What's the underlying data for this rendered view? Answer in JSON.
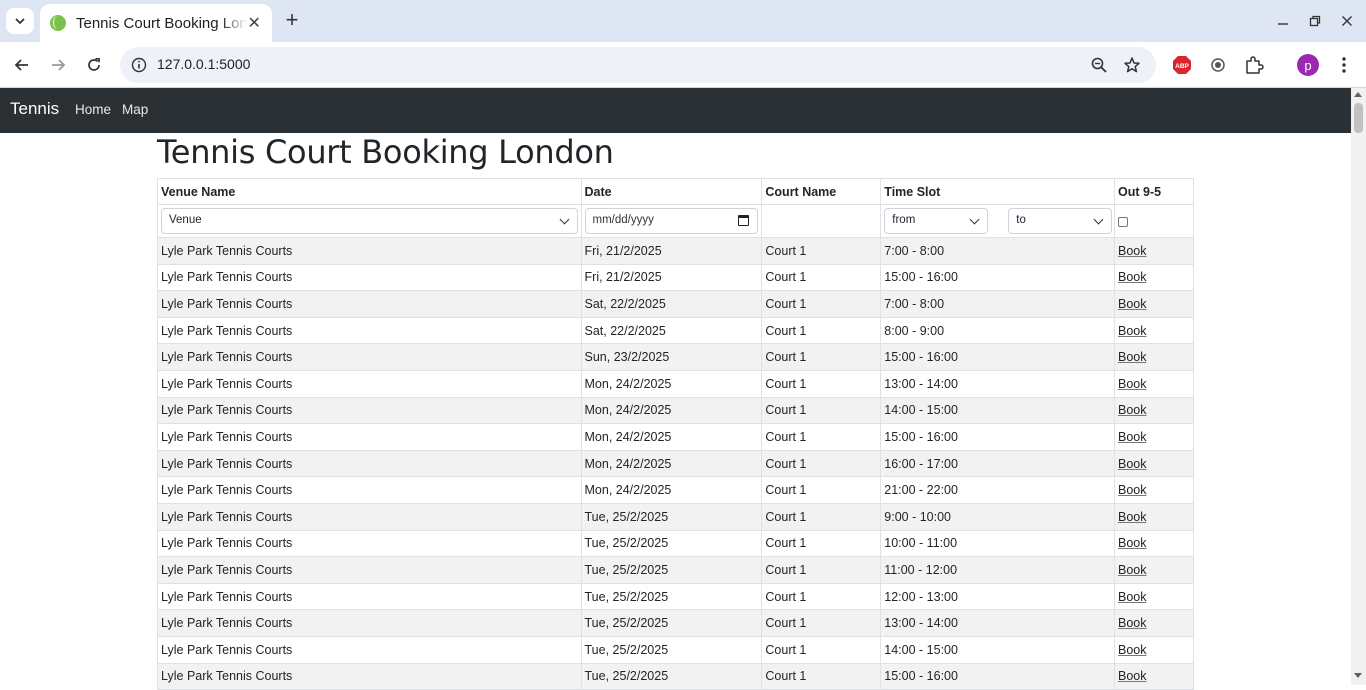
{
  "browser": {
    "tab_title": "Tennis Court Booking London",
    "url": "127.0.0.1:5000",
    "tab_close": "✕",
    "new_tab": "+",
    "profile_initial": "p",
    "abp_label": "ABP"
  },
  "navbar": {
    "brand": "Tennis",
    "links": [
      "Home",
      "Map"
    ]
  },
  "page": {
    "title": "Tennis Court Booking London"
  },
  "table": {
    "headers": {
      "venue": "Venue Name",
      "date": "Date",
      "court": "Court Name",
      "slot": "Time Slot",
      "out": "Out 9-5"
    },
    "filters": {
      "venue": "Venue",
      "date_placeholder": "mm/dd/yyyy",
      "from": "from",
      "to": "to",
      "out_checked": false
    },
    "book_label": "Book",
    "rows": [
      {
        "venue": "Lyle Park Tennis Courts",
        "date": "Fri, 21/2/2025",
        "court": "Court 1",
        "slot": "7:00 - 8:00"
      },
      {
        "venue": "Lyle Park Tennis Courts",
        "date": "Fri, 21/2/2025",
        "court": "Court 1",
        "slot": "15:00 - 16:00"
      },
      {
        "venue": "Lyle Park Tennis Courts",
        "date": "Sat, 22/2/2025",
        "court": "Court 1",
        "slot": "7:00 - 8:00"
      },
      {
        "venue": "Lyle Park Tennis Courts",
        "date": "Sat, 22/2/2025",
        "court": "Court 1",
        "slot": "8:00 - 9:00"
      },
      {
        "venue": "Lyle Park Tennis Courts",
        "date": "Sun, 23/2/2025",
        "court": "Court 1",
        "slot": "15:00 - 16:00"
      },
      {
        "venue": "Lyle Park Tennis Courts",
        "date": "Mon, 24/2/2025",
        "court": "Court 1",
        "slot": "13:00 - 14:00"
      },
      {
        "venue": "Lyle Park Tennis Courts",
        "date": "Mon, 24/2/2025",
        "court": "Court 1",
        "slot": "14:00 - 15:00"
      },
      {
        "venue": "Lyle Park Tennis Courts",
        "date": "Mon, 24/2/2025",
        "court": "Court 1",
        "slot": "15:00 - 16:00"
      },
      {
        "venue": "Lyle Park Tennis Courts",
        "date": "Mon, 24/2/2025",
        "court": "Court 1",
        "slot": "16:00 - 17:00"
      },
      {
        "venue": "Lyle Park Tennis Courts",
        "date": "Mon, 24/2/2025",
        "court": "Court 1",
        "slot": "21:00 - 22:00"
      },
      {
        "venue": "Lyle Park Tennis Courts",
        "date": "Tue, 25/2/2025",
        "court": "Court 1",
        "slot": "9:00 - 10:00"
      },
      {
        "venue": "Lyle Park Tennis Courts",
        "date": "Tue, 25/2/2025",
        "court": "Court 1",
        "slot": "10:00 - 11:00"
      },
      {
        "venue": "Lyle Park Tennis Courts",
        "date": "Tue, 25/2/2025",
        "court": "Court 1",
        "slot": "11:00 - 12:00"
      },
      {
        "venue": "Lyle Park Tennis Courts",
        "date": "Tue, 25/2/2025",
        "court": "Court 1",
        "slot": "12:00 - 13:00"
      },
      {
        "venue": "Lyle Park Tennis Courts",
        "date": "Tue, 25/2/2025",
        "court": "Court 1",
        "slot": "13:00 - 14:00"
      },
      {
        "venue": "Lyle Park Tennis Courts",
        "date": "Tue, 25/2/2025",
        "court": "Court 1",
        "slot": "14:00 - 15:00"
      },
      {
        "venue": "Lyle Park Tennis Courts",
        "date": "Tue, 25/2/2025",
        "court": "Court 1",
        "slot": "15:00 - 16:00"
      }
    ]
  },
  "colors": {
    "navbar_bg": "#2b3035",
    "tabstrip_bg": "#dfe6f3",
    "stripe": "#f2f2f2",
    "profile": "#9c27b0",
    "abp": "#d9262c"
  }
}
